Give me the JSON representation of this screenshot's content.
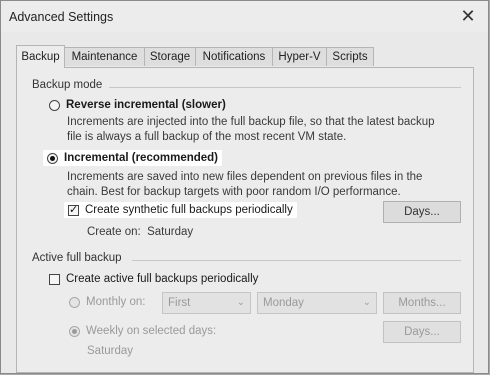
{
  "window": {
    "title": "Advanced Settings"
  },
  "tabs": [
    {
      "label": "Backup",
      "active": true
    },
    {
      "label": "Maintenance"
    },
    {
      "label": "Storage"
    },
    {
      "label": "Notifications"
    },
    {
      "label": "Hyper-V"
    },
    {
      "label": "Scripts"
    }
  ],
  "backup_mode": {
    "heading": "Backup mode",
    "reverse": {
      "label": "Reverse incremental (slower)",
      "desc_line1": "Increments are injected into the full backup file, so that the latest backup",
      "desc_line2": "file is always a full backup of the most recent VM state.",
      "checked": false
    },
    "incremental": {
      "label": "Incremental (recommended)",
      "desc_line1": "Increments are saved into new files dependent on previous files in the",
      "desc_line2": "chain. Best for backup targets with poor random I/O performance.",
      "checked": true
    },
    "synthetic": {
      "label": "Create synthetic full backups periodically",
      "checked": true,
      "create_on": "Create on:  Saturday",
      "days_button": "Days..."
    }
  },
  "active_full": {
    "heading": "Active full backup",
    "checkbox_label": "Create active full backups periodically",
    "checked": false,
    "monthly": {
      "label": "Monthly on:",
      "first_select": "First",
      "day_select": "Monday",
      "button": "Months..."
    },
    "weekly": {
      "label": "Weekly on selected days:",
      "days_text": "Saturday",
      "button": "Days..."
    }
  },
  "icons": {
    "close": "close-icon"
  }
}
